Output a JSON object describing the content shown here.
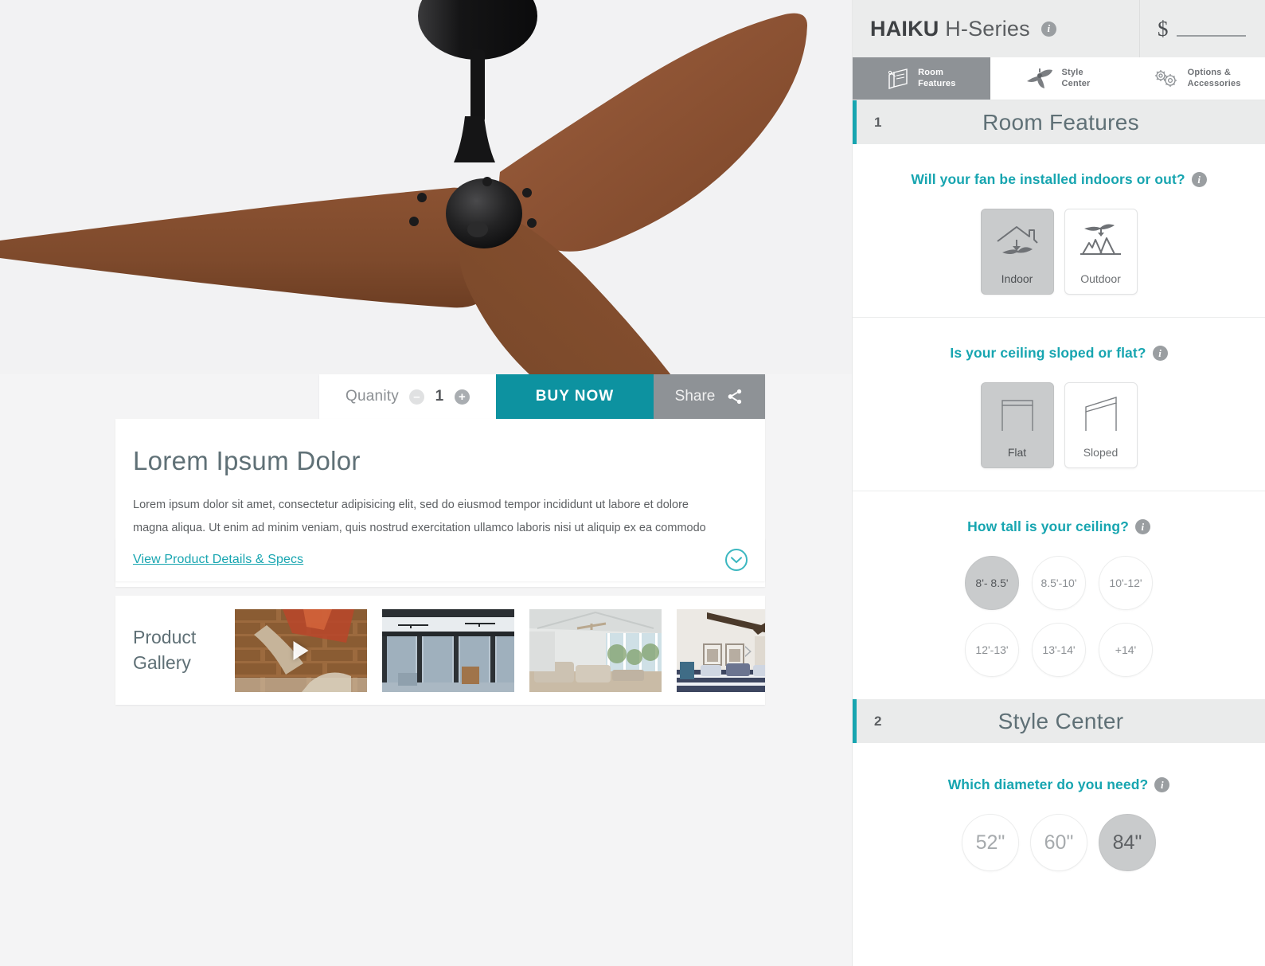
{
  "product": {
    "hero_alt": "ceiling-fan-dark-wood-blades",
    "title": "Lorem Ipsum Dolor",
    "description": "Lorem ipsum dolor sit amet, consectetur adipisicing elit, sed do eiusmod tempor incididunt ut labore et dolore magna aliqua. Ut enim ad minim veniam, quis nostrud exercitation ullamco laboris nisi ut aliquip ex ea commodo consequat.",
    "specs_link": "View Product Details & Specs"
  },
  "buybar": {
    "quantity_label": "Quanity",
    "quantity_value": "1",
    "minus_label": "–",
    "plus_label": "+",
    "buy_now_label": "BUY NOW",
    "share_label": "Share"
  },
  "gallery": {
    "label": "Product\nGallery",
    "next_arrow": "›",
    "items": [
      {
        "name": "fan-against-brick-wall",
        "has_video": true
      },
      {
        "name": "covered-patio-with-fans",
        "has_video": false
      },
      {
        "name": "vaulted-ceiling-living-room",
        "has_video": false
      },
      {
        "name": "bedroom-with-beams",
        "has_video": false
      }
    ]
  },
  "configurator": {
    "header": {
      "brand": "HAIKU",
      "series": "H-Series",
      "info_icon": "i",
      "price_symbol": "$",
      "price_value": ""
    },
    "tabs": [
      {
        "label": "Room\nFeatures",
        "icon": "room-features-icon",
        "active": true
      },
      {
        "label": "Style\nCenter",
        "icon": "ceiling-fan-icon",
        "active": false
      },
      {
        "label": "Options &\nAccessories",
        "icon": "gears-icon",
        "active": false
      }
    ],
    "sections": [
      {
        "number": "1",
        "title": "Room Features",
        "questions": [
          {
            "text": "Will your fan be installed indoors or out?",
            "type": "cards",
            "options": [
              {
                "label": "Indoor",
                "icon": "house-with-fan-icon",
                "selected": true
              },
              {
                "label": "Outdoor",
                "icon": "fan-over-trees-icon",
                "selected": false
              }
            ]
          },
          {
            "text": "Is your ceiling sloped or flat?",
            "type": "cards",
            "options": [
              {
                "label": "Flat",
                "icon": "flat-ceiling-icon",
                "selected": true
              },
              {
                "label": "Sloped",
                "icon": "sloped-ceiling-icon",
                "selected": false
              }
            ]
          },
          {
            "text": "How tall is your ceiling?",
            "type": "circles",
            "options": [
              {
                "label": "8'- 8.5'",
                "selected": true
              },
              {
                "label": "8.5'-10'",
                "selected": false
              },
              {
                "label": "10'-12'",
                "selected": false
              },
              {
                "label": "12'-13'",
                "selected": false
              },
              {
                "label": "13'-14'",
                "selected": false
              },
              {
                "label": "+14'",
                "selected": false
              }
            ]
          }
        ]
      },
      {
        "number": "2",
        "title": "Style Center",
        "questions": [
          {
            "text": "Which diameter do you need?",
            "type": "circles-large",
            "options": [
              {
                "label": "52\"",
                "selected": false
              },
              {
                "label": "60\"",
                "selected": false
              },
              {
                "label": "84\"",
                "selected": true
              }
            ]
          }
        ]
      }
    ]
  },
  "colors": {
    "teal": "#0d92a0",
    "teal_accent": "#17a5b0",
    "gray_button": "#8e9296",
    "selected_gray": "#c9cbcc",
    "heading_slate": "#5f7076"
  }
}
